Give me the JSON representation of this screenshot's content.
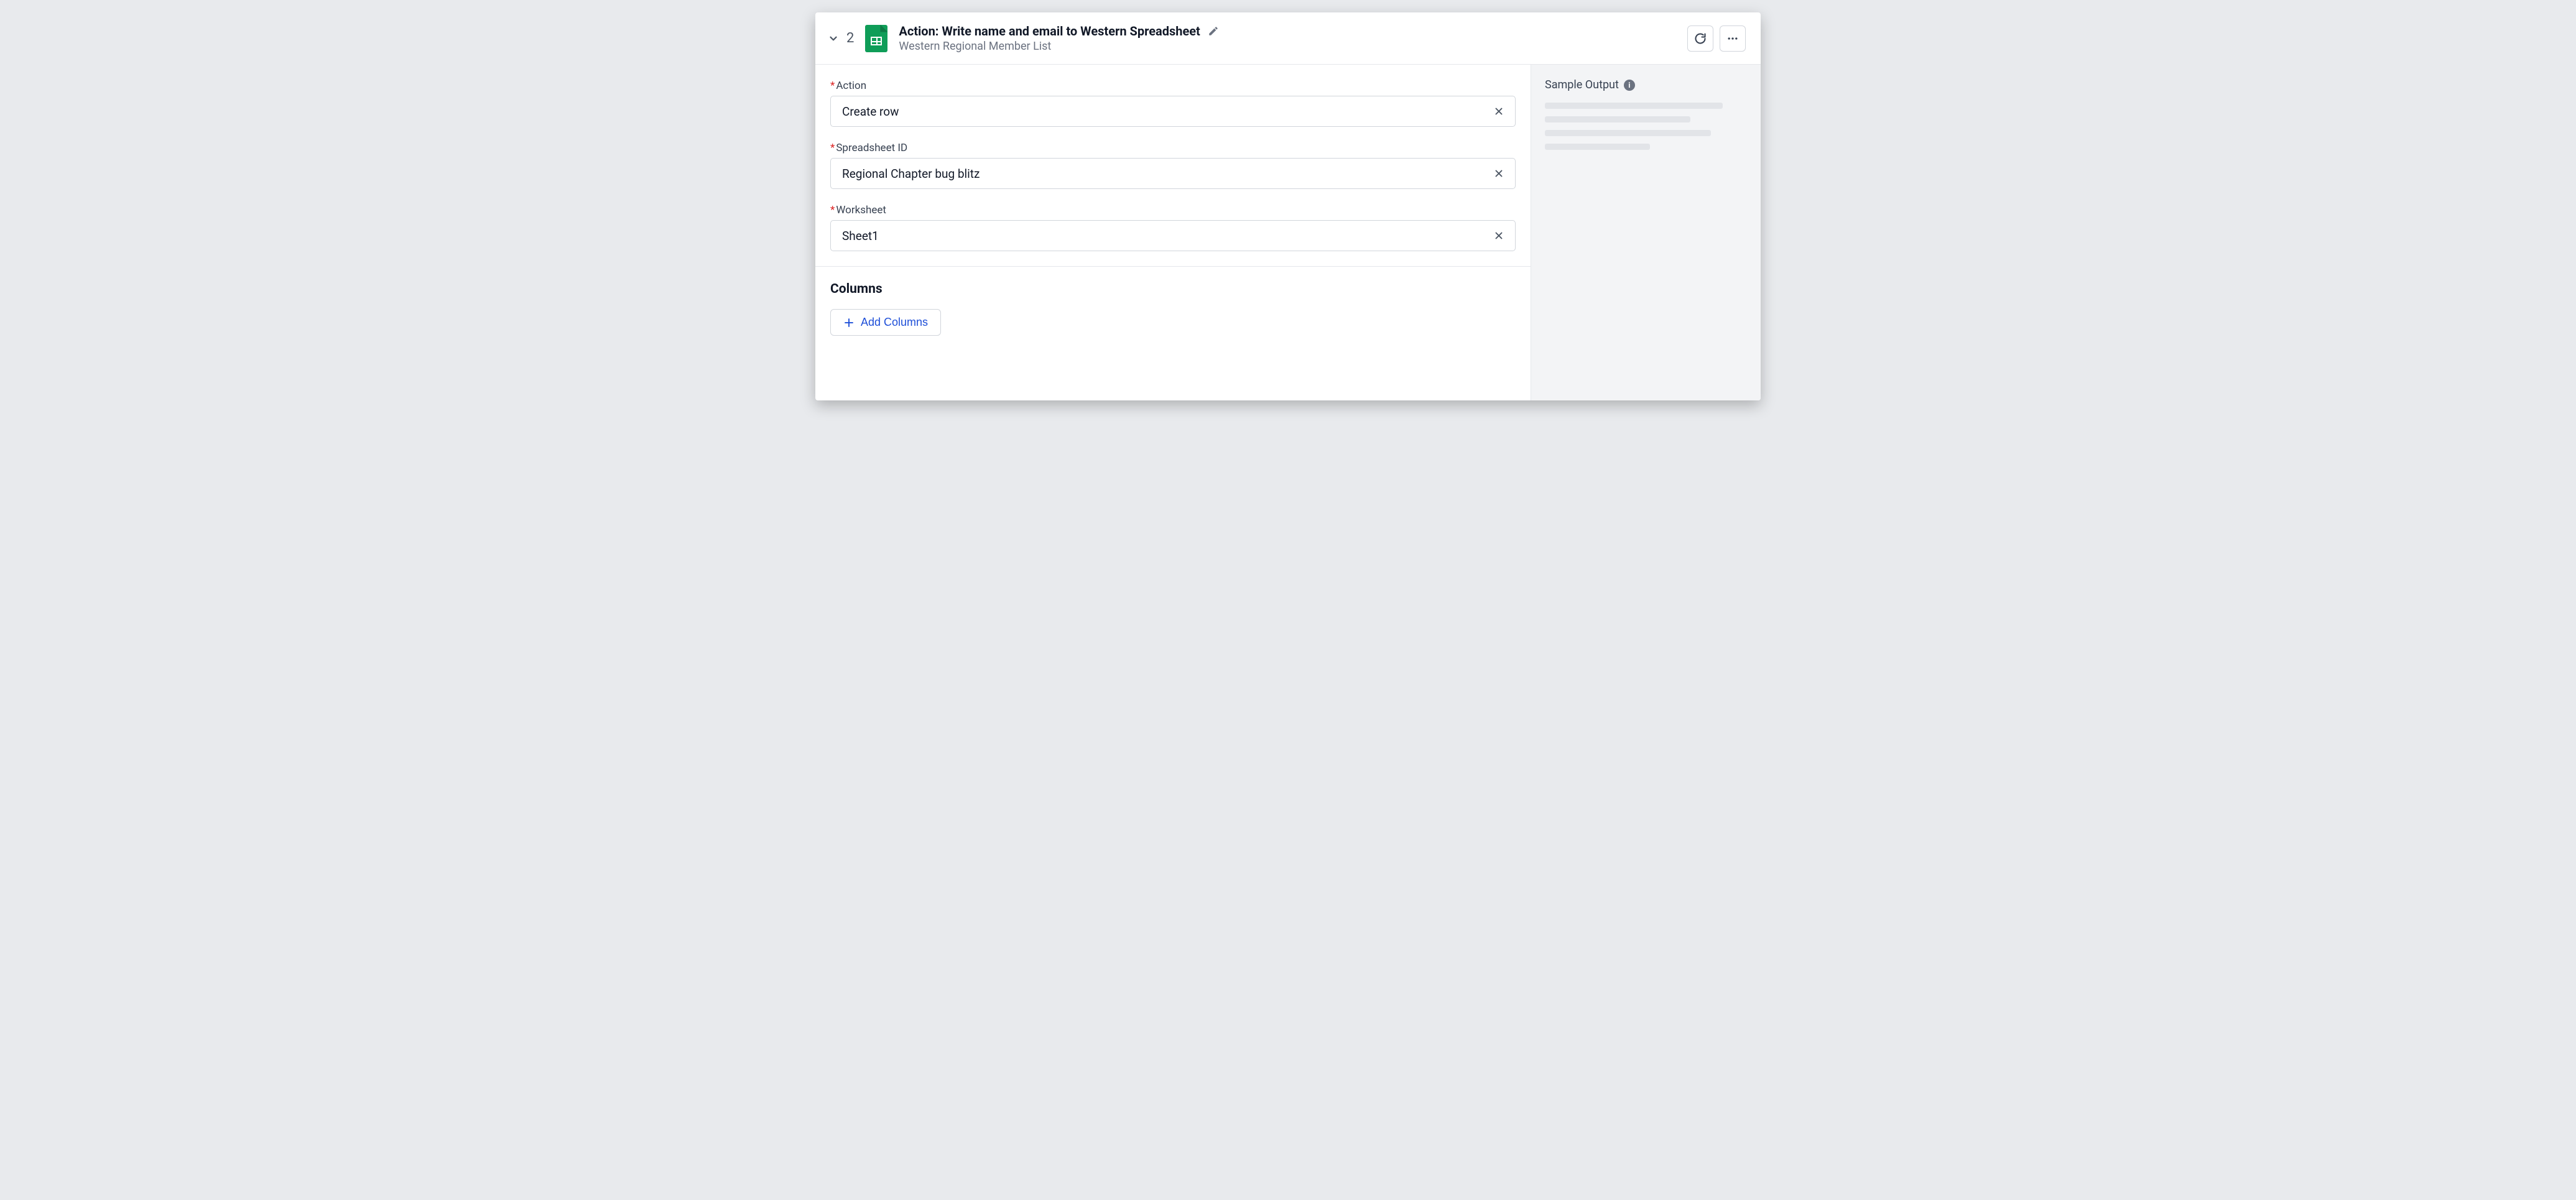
{
  "header": {
    "step_number": "2",
    "title": "Action: Write name and email to Western Spreadsheet",
    "subtitle": "Western Regional Member List"
  },
  "fields": {
    "action": {
      "label": "Action",
      "value": "Create row"
    },
    "spreadsheet": {
      "label": "Spreadsheet ID",
      "value": "Regional Chapter bug blitz"
    },
    "worksheet": {
      "label": "Worksheet",
      "value": "Sheet1"
    }
  },
  "columns": {
    "section_title": "Columns",
    "add_button_label": "Add Columns"
  },
  "sidebar": {
    "title": "Sample Output"
  }
}
